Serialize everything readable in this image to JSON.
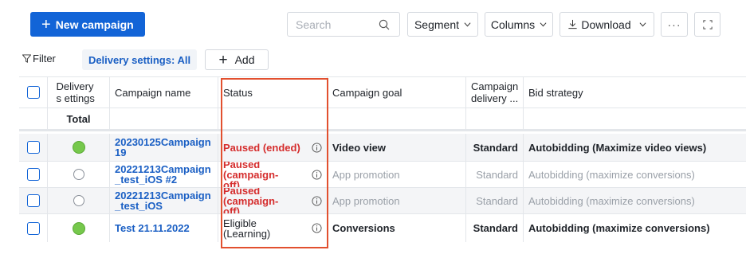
{
  "toolbar": {
    "new_campaign": "New campaign",
    "search_placeholder": "Search",
    "segment": "Segment",
    "columns": "Columns",
    "download": "Download",
    "more": "···"
  },
  "filter": {
    "label": "Filter",
    "delivery_chip": "Delivery settings: All",
    "add": "Add"
  },
  "table": {
    "headers": {
      "delivery": "Delivery s ettings",
      "name": "Campaign name",
      "status": "Status",
      "goal": "Campaign goal",
      "campaign_delivery": "Campaign delivery ...",
      "bid": "Bid strategy"
    },
    "total_label": "Total",
    "rows": [
      {
        "delivery": "on",
        "name": "20230125Campaign 19",
        "status": "Paused (ended)",
        "goal": "Video view",
        "delivery_type": "Standard",
        "bid": "Autobidding (Maximize video views)"
      },
      {
        "delivery": "off",
        "name": "20221213Campaign _test_iOS #2",
        "status": "Paused (campaign-off)",
        "goal": "App promotion",
        "delivery_type": "Standard",
        "bid": "Autobidding (maximize conversions)"
      },
      {
        "delivery": "off",
        "name": "20221213Campaign _test_iOS",
        "status": "Paused (campaign-off)",
        "goal": "App promotion",
        "delivery_type": "Standard",
        "bid": "Autobidding (maximize conversions)"
      },
      {
        "delivery": "on",
        "name": "Test 21.11.2022",
        "status": "Eligible (Learning)",
        "goal": "Conversions",
        "delivery_type": "Standard",
        "bid": "Autobidding (maximize conversions)"
      }
    ]
  },
  "colors": {
    "primary": "#1264d7",
    "link": "#1a5fc4",
    "paused": "#d52d2d",
    "active_dot": "#76c84c",
    "highlight": "#e2502f"
  }
}
